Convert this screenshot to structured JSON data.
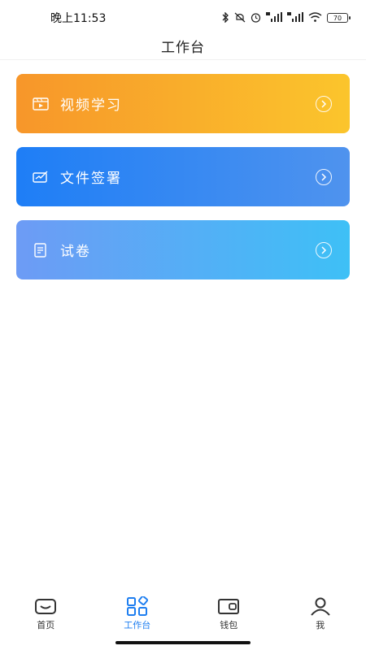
{
  "status_bar": {
    "time": "晚上11:53",
    "battery": "70"
  },
  "header": {
    "title": "工作台"
  },
  "cards": [
    {
      "label": "视频学习",
      "icon": "video-icon",
      "gradient": [
        "#f7962a",
        "#fbc52c"
      ]
    },
    {
      "label": "文件签署",
      "icon": "sign-document-icon",
      "gradient": [
        "#1e7ef6",
        "#4f93ee"
      ]
    },
    {
      "label": "试卷",
      "icon": "exam-paper-icon",
      "gradient": [
        "#6d9bf5",
        "#3ec0f6"
      ]
    }
  ],
  "bottom_nav": [
    {
      "label": "首页",
      "icon": "home-icon",
      "active": false
    },
    {
      "label": "工作台",
      "icon": "workbench-icon",
      "active": true
    },
    {
      "label": "钱包",
      "icon": "wallet-icon",
      "active": false
    },
    {
      "label": "我",
      "icon": "user-icon",
      "active": false
    }
  ],
  "colors": {
    "accent": "#1e7ef0"
  }
}
